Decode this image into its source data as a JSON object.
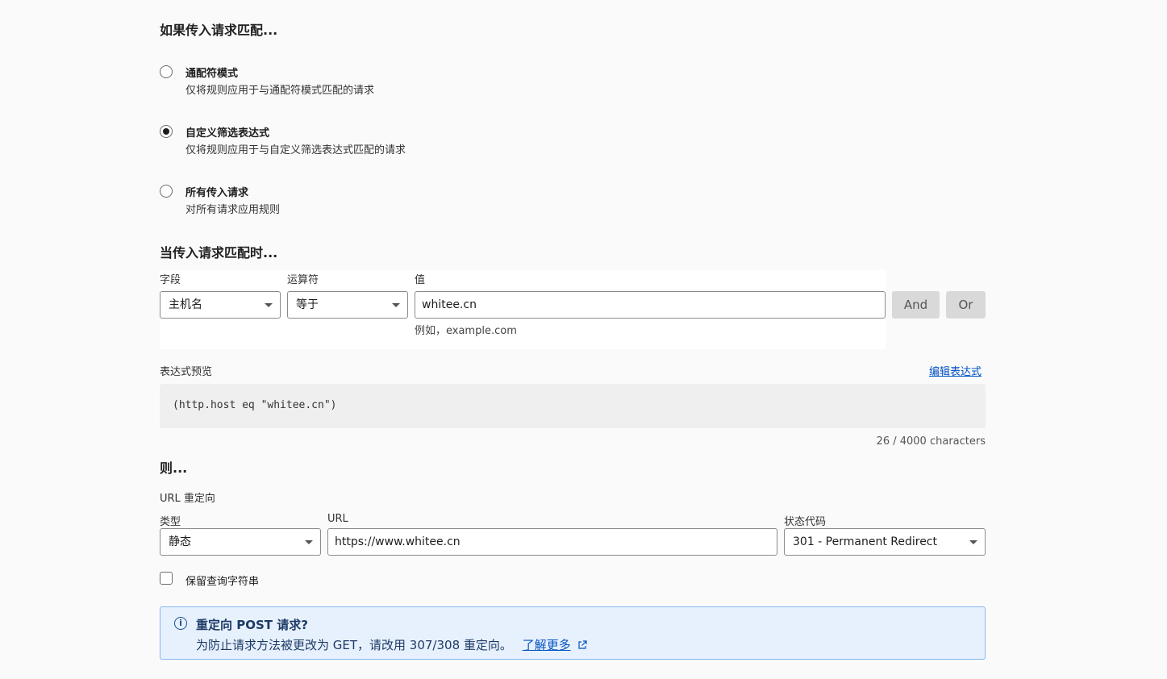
{
  "match": {
    "heading": "如果传入请求匹配...",
    "options": [
      {
        "title": "通配符模式",
        "desc": "仅将规则应用于与通配符模式匹配的请求",
        "checked": false
      },
      {
        "title": "自定义筛选表达式",
        "desc": "仅将规则应用于与自定义筛选表达式匹配的请求",
        "checked": true
      },
      {
        "title": "所有传入请求",
        "desc": "对所有请求应用规则",
        "checked": false
      }
    ]
  },
  "when": {
    "heading": "当传入请求匹配时...",
    "field_label": "字段",
    "field_value": "主机名",
    "operator_label": "运算符",
    "operator_value": "等于",
    "value_label": "值",
    "value_input": "whitee.cn",
    "value_hint": "例如，example.com",
    "and_label": "And",
    "or_label": "Or"
  },
  "preview": {
    "label": "表达式预览",
    "edit_link": "编辑表达式",
    "expression": "(http.host eq \"whitee.cn\")",
    "char_count": "26 / 4000 characters"
  },
  "then": {
    "heading": "则...",
    "action": "URL 重定向",
    "type_label": "类型",
    "type_value": "静态",
    "url_label": "URL",
    "url_value": "https://www.whitee.cn",
    "status_label": "状态代码",
    "status_value": "301 - Permanent Redirect",
    "preserve_query": "保留查询字符串"
  },
  "notice": {
    "title": "重定向 POST 请求?",
    "body": "为防止请求方法被更改为 GET，请改用 307/308 重定向。",
    "link": "了解更多",
    "icon": "info-icon",
    "accent": "#0051c3",
    "background": "#e7f1fd"
  }
}
